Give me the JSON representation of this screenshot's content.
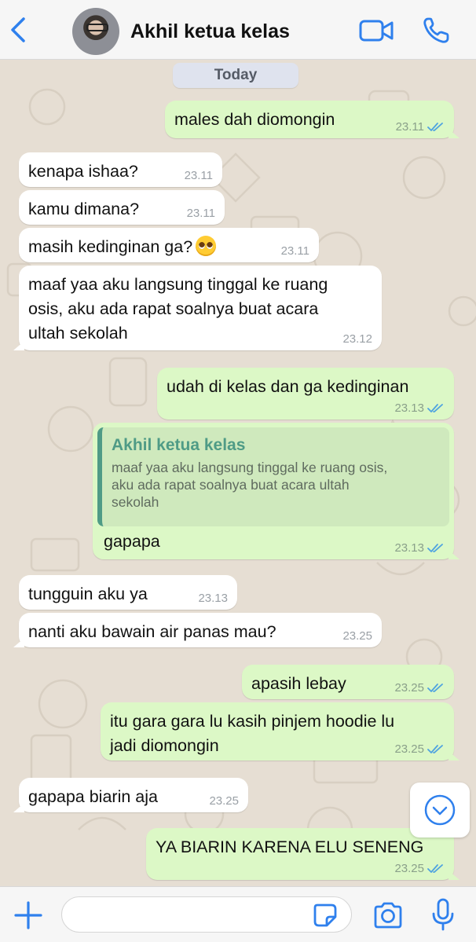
{
  "header": {
    "contact_name": "Akhil ketua kelas",
    "back_icon": "chevron-left-icon",
    "video_icon": "video-camera-icon",
    "call_icon": "phone-icon"
  },
  "colors": {
    "accent": "#2f80ed",
    "outgoing_bubble": "#dcf8c6",
    "incoming_bubble": "#ffffff",
    "read_ticks": "#4fa3e0",
    "quote_accent": "#4f9b86",
    "wallpaper": "#e6ded3"
  },
  "chat": {
    "date_label": "Today",
    "messages": [
      {
        "dir": "out",
        "text": "males dah diomongin",
        "time": "23.11",
        "status": "read"
      },
      {
        "dir": "in",
        "text": "kenapa ishaa?",
        "time": "23.11"
      },
      {
        "dir": "in",
        "text": "kamu dimana?",
        "time": "23.11"
      },
      {
        "dir": "in",
        "text": "masih kedinginan ga?",
        "emoji": "pleading-face",
        "time": "23.11"
      },
      {
        "dir": "in",
        "text": "maaf yaa aku langsung tinggal ke ruang\nosis, aku ada rapat soalnya buat acara\nultah sekolah",
        "time": "23.12"
      },
      {
        "dir": "out",
        "text": "udah di kelas dan ga kedinginan",
        "time": "23.13",
        "status": "read"
      },
      {
        "dir": "out",
        "quote": {
          "author": "Akhil ketua kelas",
          "text": "maaf yaa aku langsung tinggal ke ruang osis,\naku ada rapat soalnya buat acara ultah\nsekolah"
        },
        "text": "gapapa",
        "time": "23.13",
        "status": "read"
      },
      {
        "dir": "in",
        "text": "tungguin aku ya",
        "time": "23.13"
      },
      {
        "dir": "in",
        "text": "nanti aku bawain air panas mau?",
        "time": "23.25"
      },
      {
        "dir": "out",
        "text": "apasih lebay",
        "time": "23.25",
        "status": "read"
      },
      {
        "dir": "out",
        "text": "itu gara gara lu kasih pinjem hoodie lu\njadi diomongin",
        "time": "23.25",
        "status": "read"
      },
      {
        "dir": "in",
        "text": "gapapa biarin aja",
        "time": "23.25"
      },
      {
        "dir": "out",
        "text": "YA BIARIN KARENA ELU SENENG",
        "time": "23.25",
        "status": "read"
      }
    ],
    "scroll_icon": "chevron-down-circle-icon"
  },
  "input_bar": {
    "message_value": "",
    "message_placeholder": "",
    "plus_icon": "plus-icon",
    "sticker_icon": "sticker-icon",
    "camera_icon": "camera-icon",
    "mic_icon": "microphone-icon"
  }
}
